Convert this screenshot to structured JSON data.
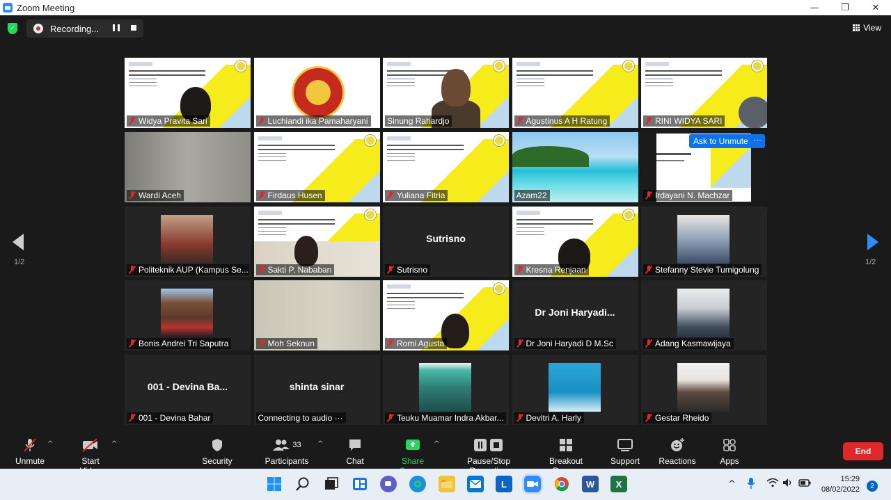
{
  "window": {
    "title": "Zoom Meeting",
    "minimize": "—",
    "maximize": "❐",
    "close": "✕"
  },
  "topbar": {
    "recording_label": "Recording...",
    "view_label": "View"
  },
  "gallery": {
    "page_left": "1/2",
    "page_right": "1/2",
    "ask_to_unmute": "Ask to Unmute",
    "more": "···",
    "tiles": [
      {
        "name": "Widya Pravita Sari"
      },
      {
        "name": "Luchiandi ika Pamaharyani"
      },
      {
        "name": "Sinung Rahardjo"
      },
      {
        "name": "Agustinus A H Ratung"
      },
      {
        "name": "RINI  WIDYA SARI"
      },
      {
        "name": "Wardi Aceh"
      },
      {
        "name": "Firdaus Husen"
      },
      {
        "name": "Yuliana Fitria"
      },
      {
        "name": "Azam22"
      },
      {
        "name": "Irdayani N. Machzar"
      },
      {
        "name": "Politeknik AUP (Kampus Se..."
      },
      {
        "name": "Sakti P. Nababan"
      },
      {
        "name": "Sutrisno",
        "display": "Sutrisno"
      },
      {
        "name": "Kresna Renjaan"
      },
      {
        "name": "Stefanny Stevie Tumigolung"
      },
      {
        "name": "Bonis Andrei Tri Saputra"
      },
      {
        "name": "Moh Seknun"
      },
      {
        "name": "Romi Agusta"
      },
      {
        "name": "Dr Joni Haryadi D M.Sc",
        "display": "Dr Joni  Haryadi..."
      },
      {
        "name": "Adang Kasmawijaya"
      },
      {
        "name": "001 - Devina Bahar",
        "display": "001 - Devina Ba..."
      },
      {
        "name": "Connecting to audio ···",
        "display": "shinta sinar"
      },
      {
        "name": "Teuku Muamar Indra Akbar..."
      },
      {
        "name": "Devitri A. Harly"
      },
      {
        "name": "Gestar Rheido"
      }
    ]
  },
  "toolbar": {
    "unmute": "Unmute",
    "start_video": "Start Video",
    "security": "Security",
    "participants": "Participants",
    "participants_count": "33",
    "chat": "Chat",
    "share_screen": "Share Screen",
    "pause_stop": "Pause/Stop Recording",
    "breakout": "Breakout Rooms",
    "support": "Support",
    "reactions": "Reactions",
    "apps": "Apps",
    "end": "End"
  },
  "taskbar": {
    "time": "15:29",
    "date": "08/02/2022",
    "notifications": "2",
    "linkedin_letter": "L"
  }
}
